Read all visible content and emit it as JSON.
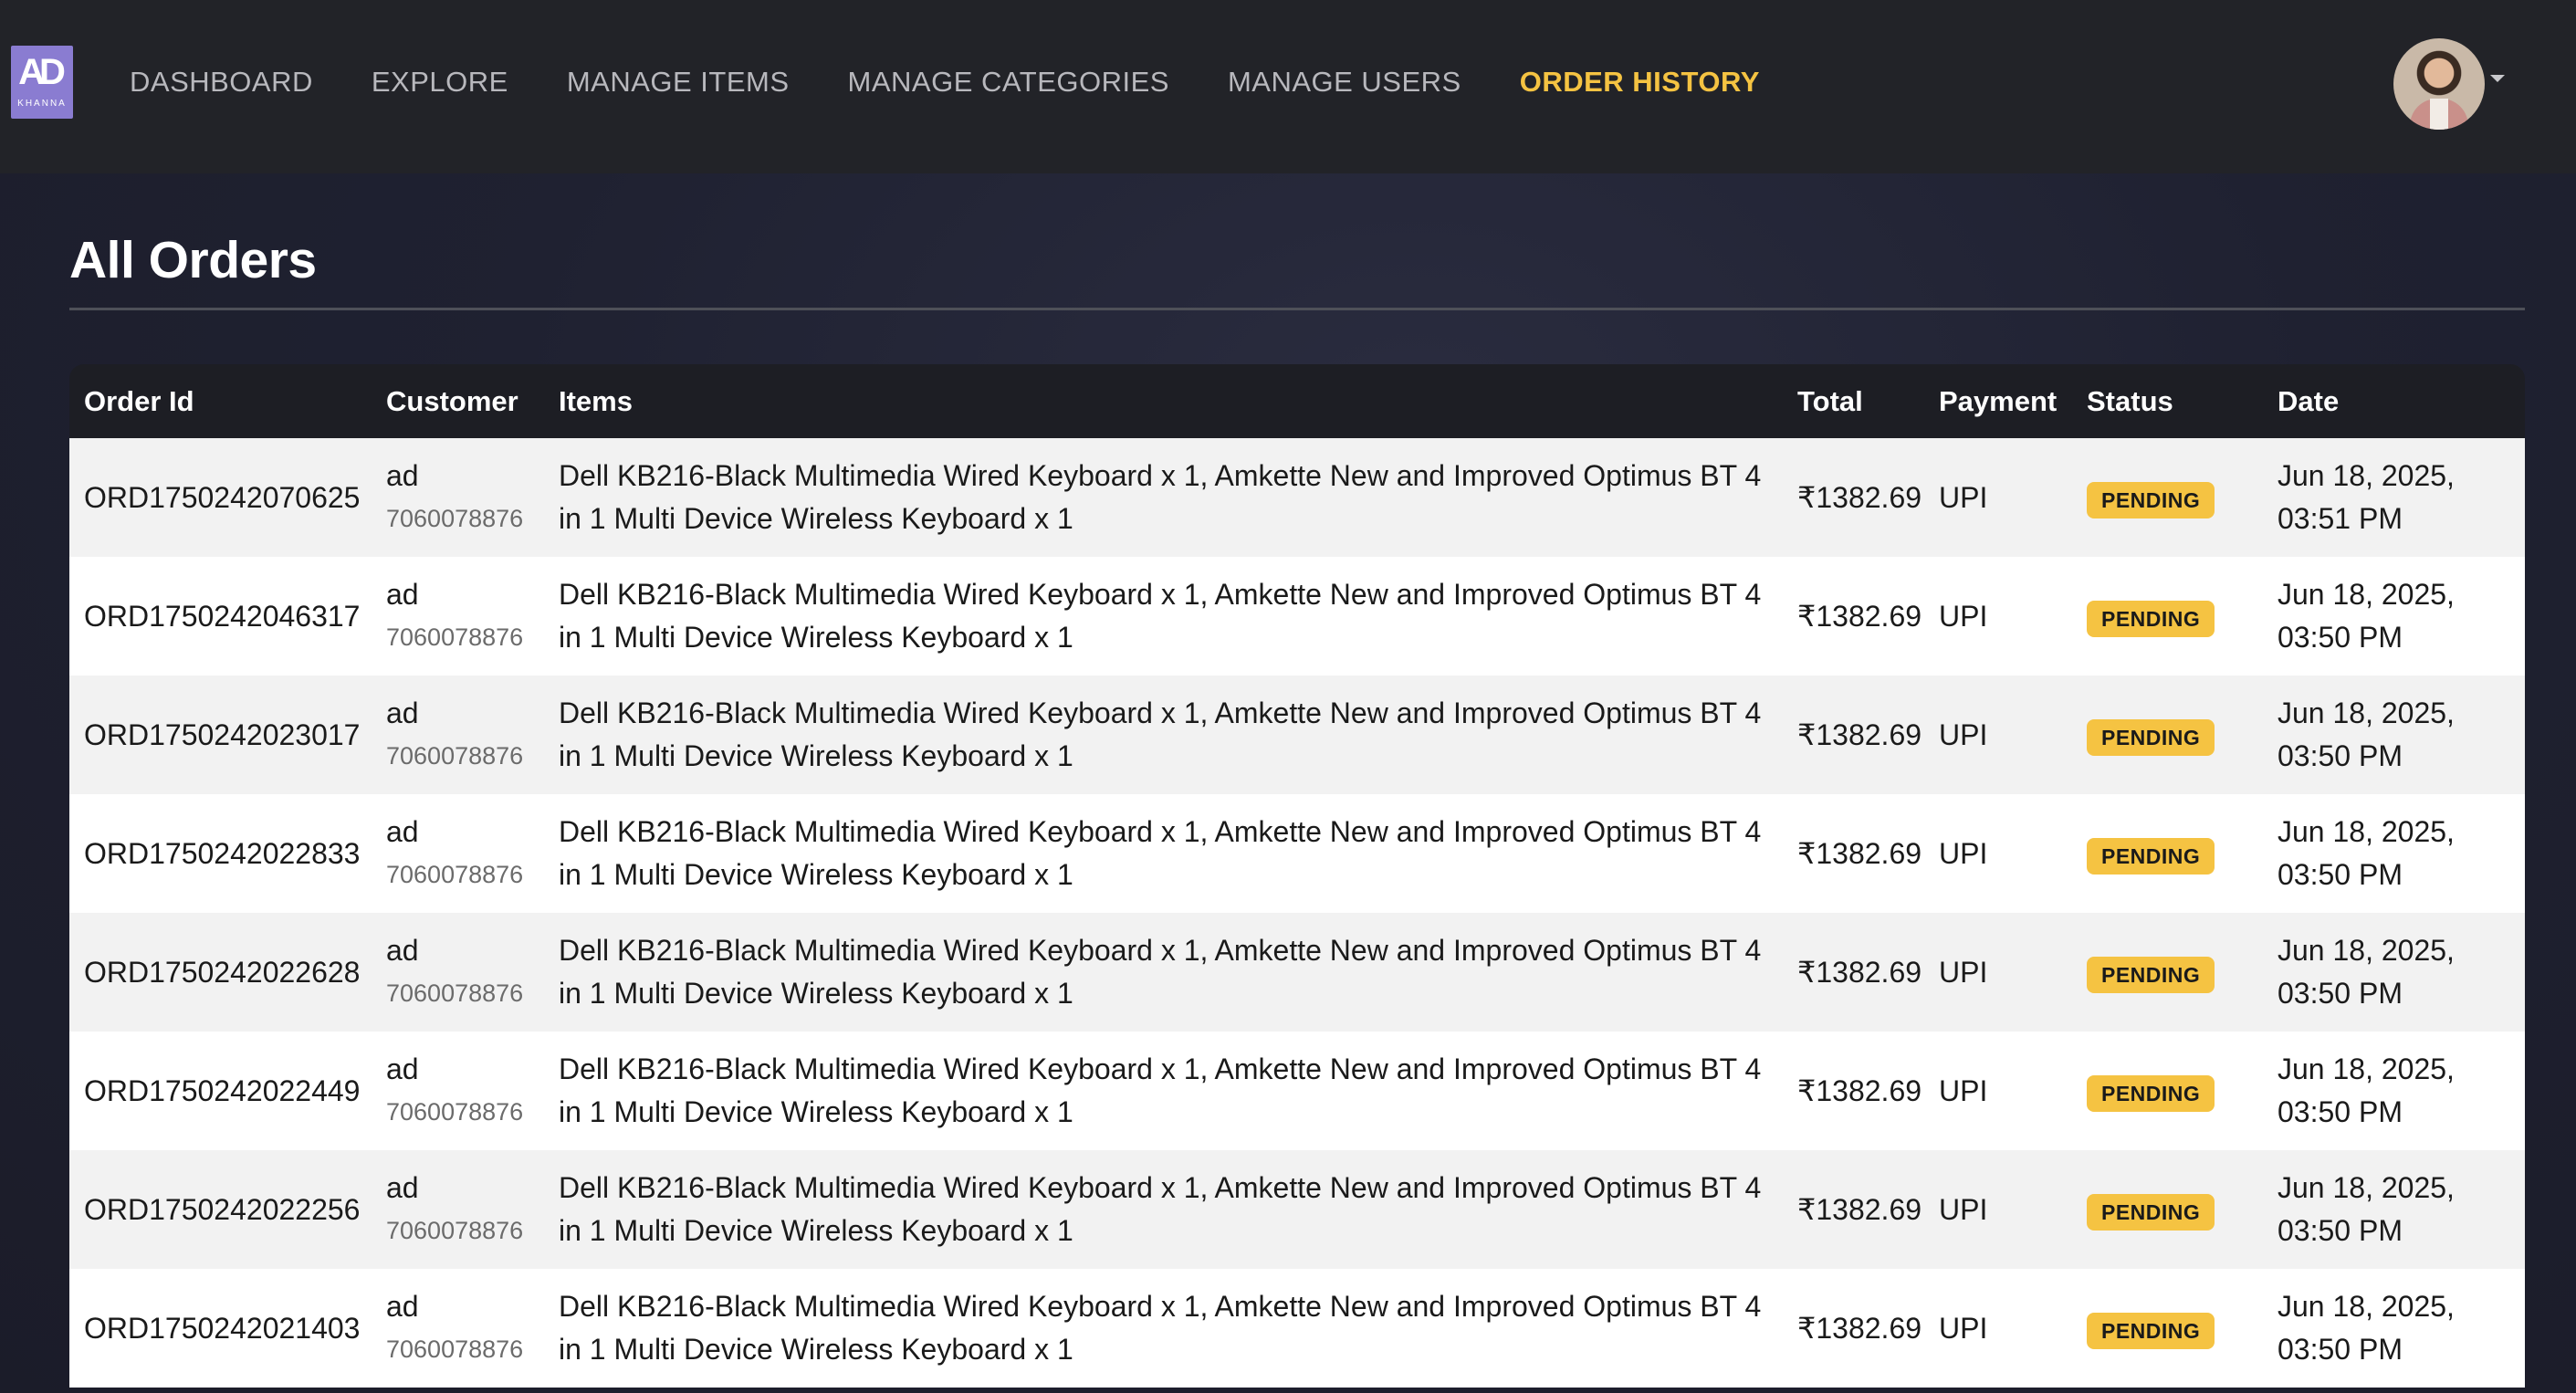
{
  "logo": {
    "mark": "AD",
    "sub": "KHANNA"
  },
  "nav": {
    "items": [
      {
        "label": "DASHBOARD",
        "active": false
      },
      {
        "label": "EXPLORE",
        "active": false
      },
      {
        "label": "MANAGE ITEMS",
        "active": false
      },
      {
        "label": "MANAGE CATEGORIES",
        "active": false
      },
      {
        "label": "MANAGE USERS",
        "active": false
      },
      {
        "label": "ORDER HISTORY",
        "active": true
      }
    ],
    "active_color": "#f5c342"
  },
  "page": {
    "title": "All Orders"
  },
  "table": {
    "headers": [
      "Order Id",
      "Customer",
      "Items",
      "Total",
      "Payment",
      "Status",
      "Date"
    ],
    "rows": [
      {
        "order_id": "ORD1750242070625",
        "customer_name": "ad",
        "customer_phone": "7060078876",
        "items": "Dell KB216-Black Multimedia Wired Keyboard x 1, Amkette New and Improved Optimus BT 4 in 1 Multi Device Wireless Keyboard x 1",
        "total": "₹1382.69",
        "payment": "UPI",
        "status": "PENDING",
        "date": "Jun 18, 2025, 03:51 PM"
      },
      {
        "order_id": "ORD1750242046317",
        "customer_name": "ad",
        "customer_phone": "7060078876",
        "items": "Dell KB216-Black Multimedia Wired Keyboard x 1, Amkette New and Improved Optimus BT 4 in 1 Multi Device Wireless Keyboard x 1",
        "total": "₹1382.69",
        "payment": "UPI",
        "status": "PENDING",
        "date": "Jun 18, 2025, 03:50 PM"
      },
      {
        "order_id": "ORD1750242023017",
        "customer_name": "ad",
        "customer_phone": "7060078876",
        "items": "Dell KB216-Black Multimedia Wired Keyboard x 1, Amkette New and Improved Optimus BT 4 in 1 Multi Device Wireless Keyboard x 1",
        "total": "₹1382.69",
        "payment": "UPI",
        "status": "PENDING",
        "date": "Jun 18, 2025, 03:50 PM"
      },
      {
        "order_id": "ORD1750242022833",
        "customer_name": "ad",
        "customer_phone": "7060078876",
        "items": "Dell KB216-Black Multimedia Wired Keyboard x 1, Amkette New and Improved Optimus BT 4 in 1 Multi Device Wireless Keyboard x 1",
        "total": "₹1382.69",
        "payment": "UPI",
        "status": "PENDING",
        "date": "Jun 18, 2025, 03:50 PM"
      },
      {
        "order_id": "ORD1750242022628",
        "customer_name": "ad",
        "customer_phone": "7060078876",
        "items": "Dell KB216-Black Multimedia Wired Keyboard x 1, Amkette New and Improved Optimus BT 4 in 1 Multi Device Wireless Keyboard x 1",
        "total": "₹1382.69",
        "payment": "UPI",
        "status": "PENDING",
        "date": "Jun 18, 2025, 03:50 PM"
      },
      {
        "order_id": "ORD1750242022449",
        "customer_name": "ad",
        "customer_phone": "7060078876",
        "items": "Dell KB216-Black Multimedia Wired Keyboard x 1, Amkette New and Improved Optimus BT 4 in 1 Multi Device Wireless Keyboard x 1",
        "total": "₹1382.69",
        "payment": "UPI",
        "status": "PENDING",
        "date": "Jun 18, 2025, 03:50 PM"
      },
      {
        "order_id": "ORD1750242022256",
        "customer_name": "ad",
        "customer_phone": "7060078876",
        "items": "Dell KB216-Black Multimedia Wired Keyboard x 1, Amkette New and Improved Optimus BT 4 in 1 Multi Device Wireless Keyboard x 1",
        "total": "₹1382.69",
        "payment": "UPI",
        "status": "PENDING",
        "date": "Jun 18, 2025, 03:50 PM"
      },
      {
        "order_id": "ORD1750242021403",
        "customer_name": "ad",
        "customer_phone": "7060078876",
        "items": "Dell KB216-Black Multimedia Wired Keyboard x 1, Amkette New and Improved Optimus BT 4 in 1 Multi Device Wireless Keyboard x 1",
        "total": "₹1382.69",
        "payment": "UPI",
        "status": "PENDING",
        "date": "Jun 18, 2025, 03:50 PM"
      }
    ]
  },
  "colors": {
    "nav_bg": "#222328",
    "page_bg": "#1f2131",
    "badge_pending": "#f5c342"
  },
  "icons": {
    "avatar": "user-avatar",
    "caret": "chevron-down-icon"
  }
}
